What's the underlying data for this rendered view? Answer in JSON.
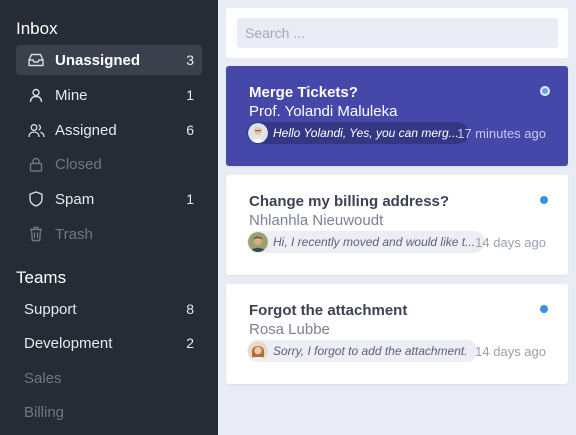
{
  "sidebar": {
    "inbox_title": "Inbox",
    "items": [
      {
        "label": "Unassigned",
        "count": "3",
        "icon": "inbox-icon"
      },
      {
        "label": "Mine",
        "count": "1",
        "icon": "user-icon"
      },
      {
        "label": "Assigned",
        "count": "6",
        "icon": "users-icon"
      },
      {
        "label": "Closed",
        "count": "",
        "icon": "lock-icon"
      },
      {
        "label": "Spam",
        "count": "1",
        "icon": "shield-icon"
      },
      {
        "label": "Trash",
        "count": "",
        "icon": "trash-icon"
      }
    ],
    "teams_title": "Teams",
    "teams": [
      {
        "label": "Support",
        "count": "8"
      },
      {
        "label": "Development",
        "count": "2"
      },
      {
        "label": "Sales",
        "count": ""
      },
      {
        "label": "Billing",
        "count": ""
      }
    ]
  },
  "search": {
    "placeholder": "Search ...",
    "value": ""
  },
  "conversations": [
    {
      "subject": "Merge Tickets?",
      "sender": "Prof. Yolandi Maluleka",
      "preview": "Hello Yolandi, Yes, you can merg...",
      "time": "17 minutes ago",
      "selected": true
    },
    {
      "subject": "Change my billing address?",
      "sender": "Nhlanhla Nieuwoudt",
      "preview": "Hi, I recently moved and would like t...",
      "time": "14 days ago",
      "selected": false
    },
    {
      "subject": "Forgot the attachment",
      "sender": "Rosa Lubbe",
      "preview": "Sorry, I forgot to add the attachment.",
      "time": "14 days ago",
      "selected": false
    }
  ],
  "colors": {
    "sidebar_bg": "#262c36",
    "active_card": "#4547a9",
    "unread_dot": "#3d8fe0",
    "main_bg": "#e9ecf4"
  }
}
